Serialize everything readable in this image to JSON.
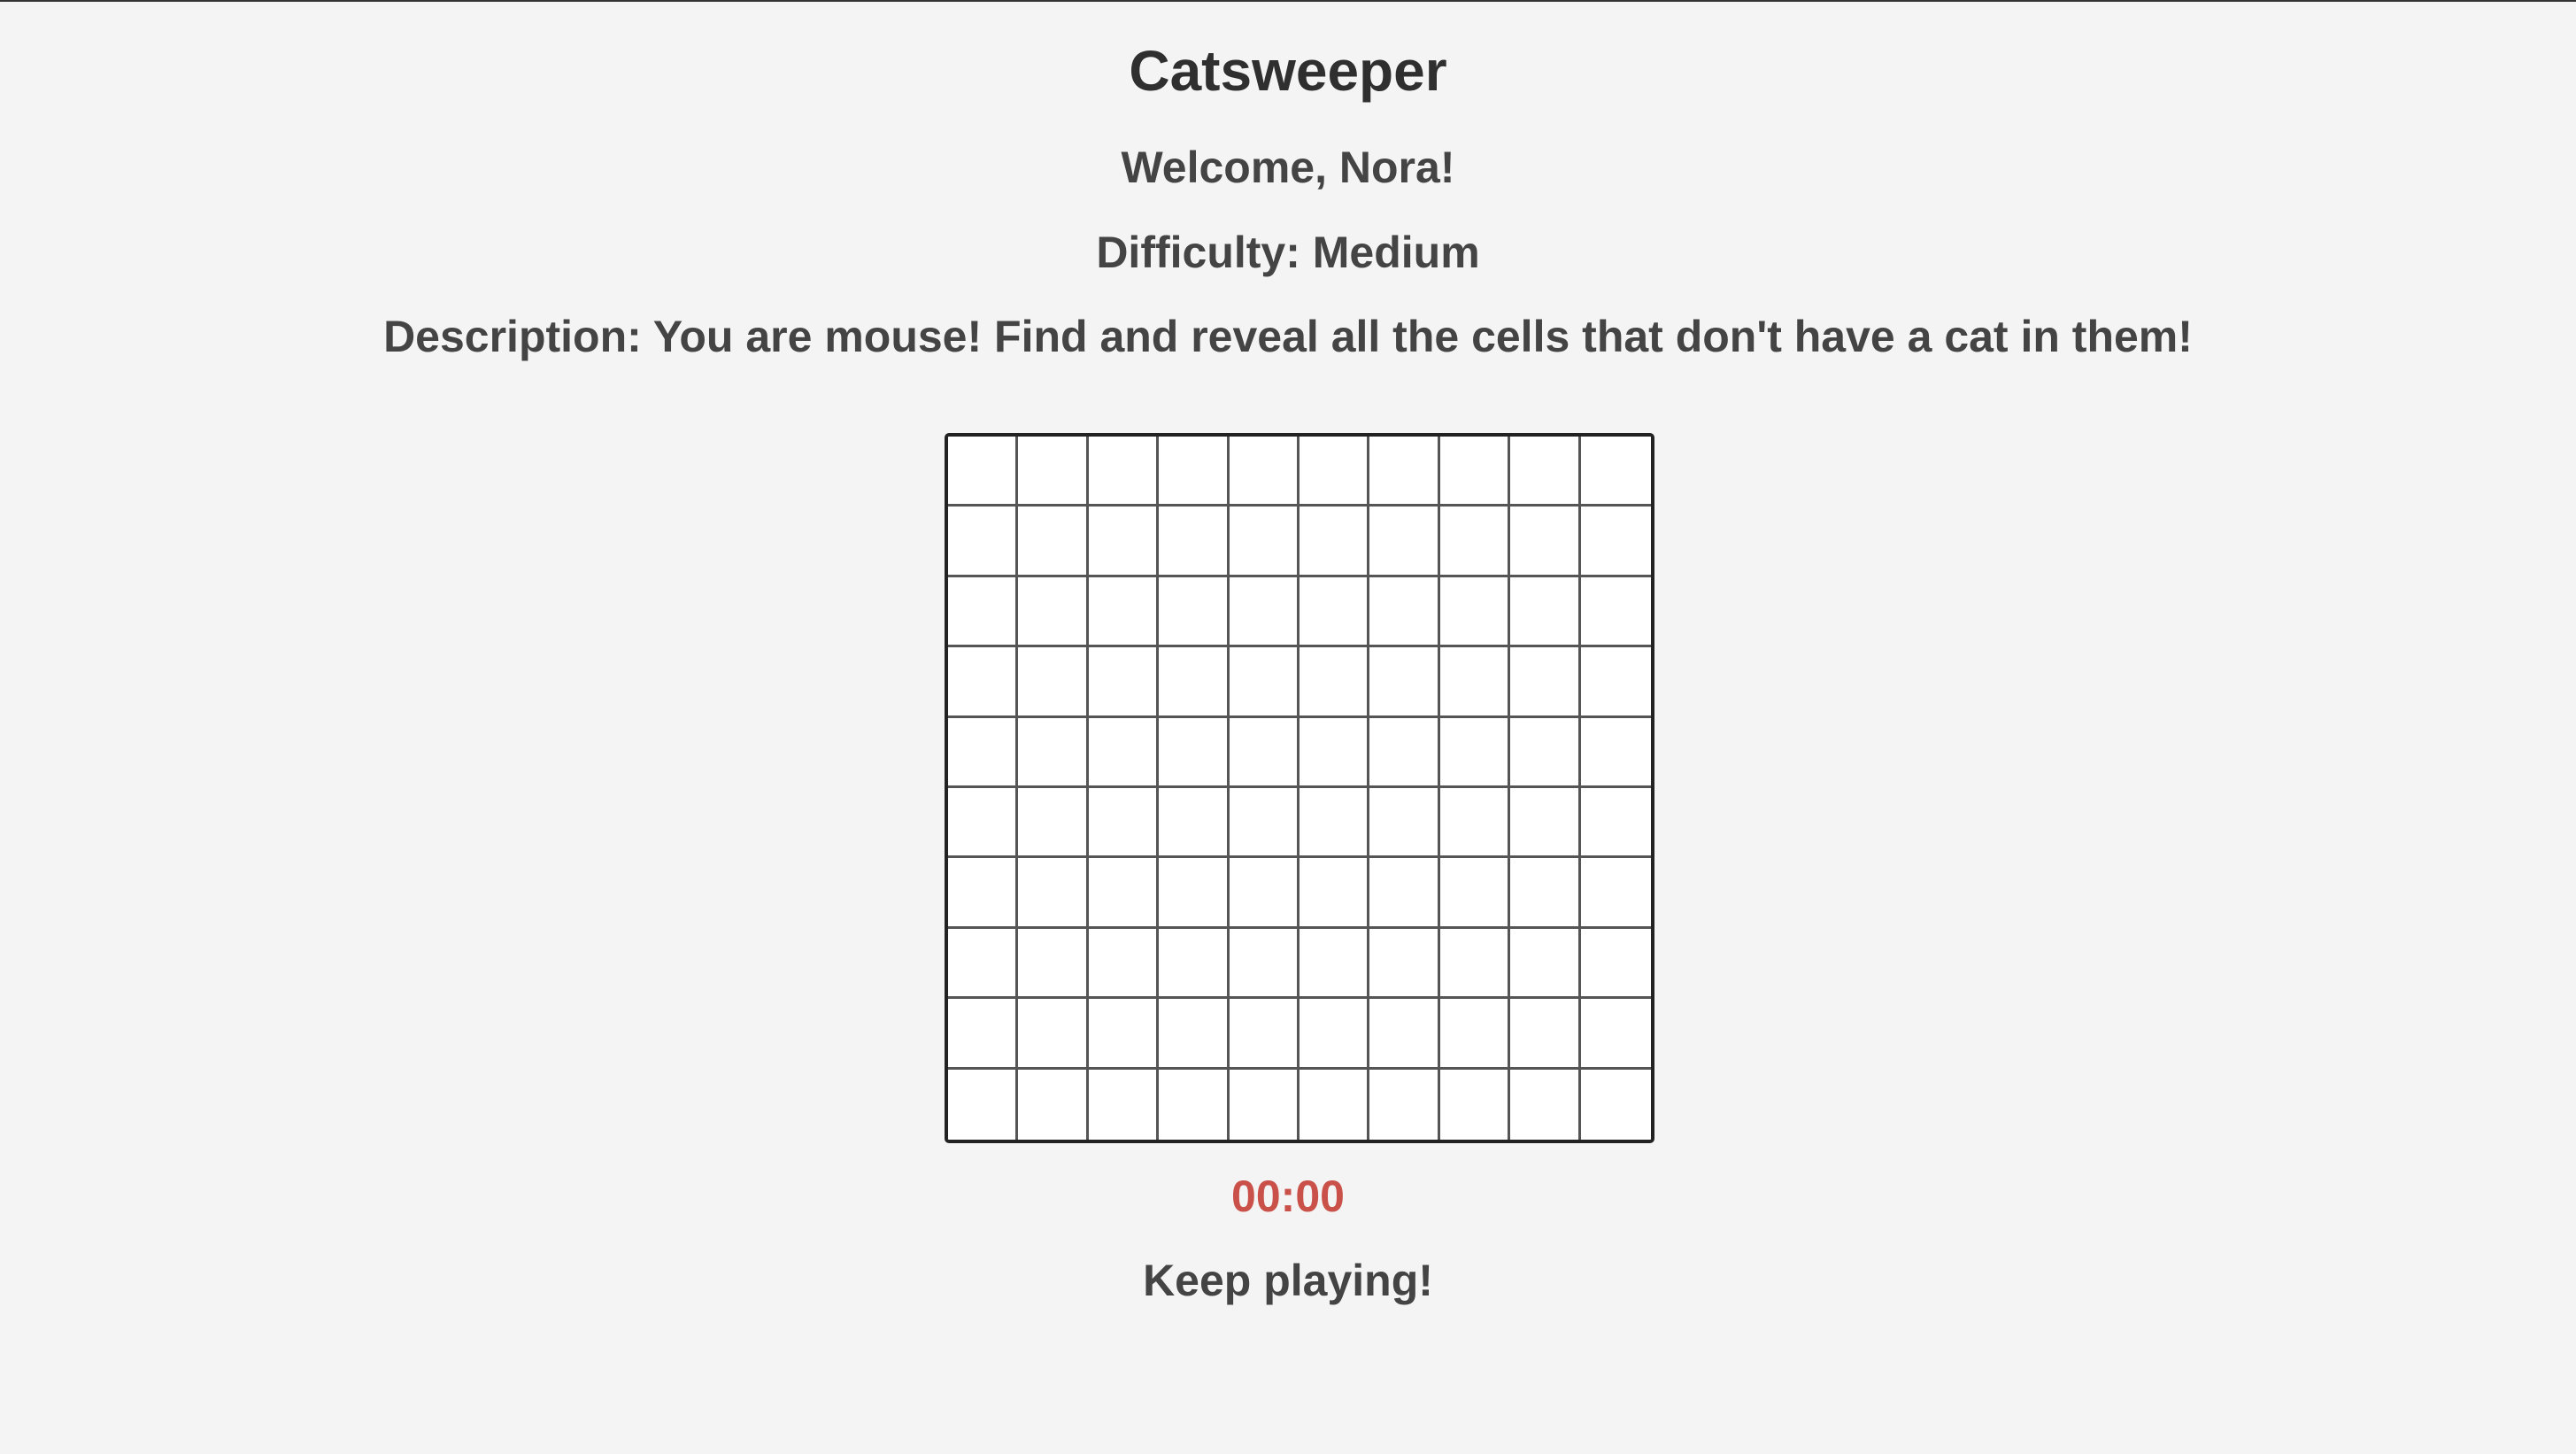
{
  "game": {
    "title": "Catsweeper",
    "welcome": "Welcome, Nora!",
    "difficulty": "Difficulty: Medium",
    "description": "Description: You are mouse! Find and reveal all the cells that don't have a cat in them!",
    "timer": "00:00",
    "status": "Keep playing!"
  },
  "board": {
    "rows": 10,
    "cols": 10,
    "cells_revealed": 0
  },
  "colors": {
    "background": "#f4f4f4",
    "timer": "#c9514a",
    "text": "#444444",
    "title": "#2f2f2f",
    "cell": "#ffffff",
    "grid_line": "#555555"
  }
}
